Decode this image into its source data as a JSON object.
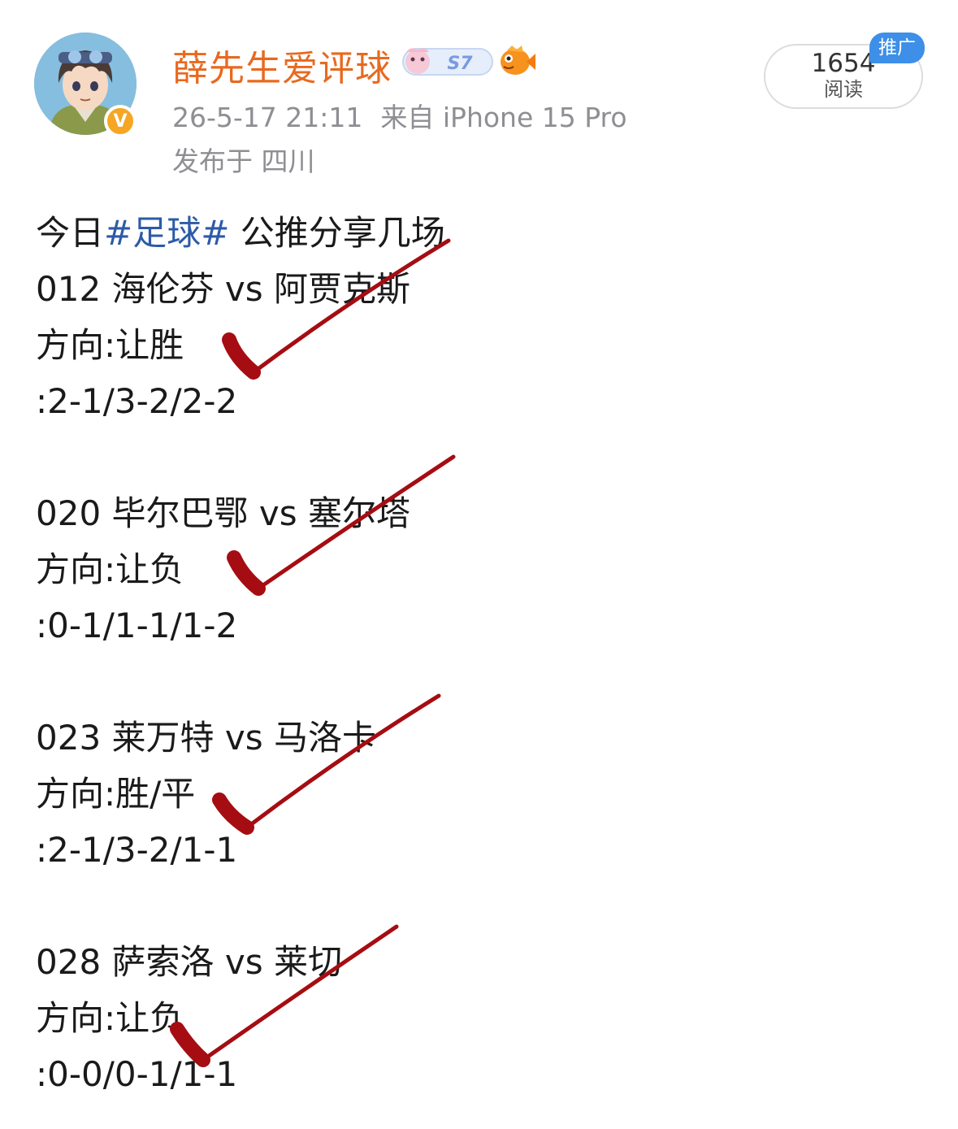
{
  "user": {
    "name": "薛先生爱评球",
    "badge_text": "S7",
    "verified_mark": "V",
    "avatar_icon": "anime-avatar-icon"
  },
  "meta": {
    "datetime": "26-5-17 21:11",
    "source": "来自 iPhone 15 Pro",
    "location": "发布于 四川"
  },
  "reads": {
    "count": "1654",
    "label": "阅读",
    "promo": "推广"
  },
  "post": {
    "intro_before": "今日",
    "hashtag": "#足球#",
    "intro_after": " 公推分享几场",
    "matches": [
      {
        "title": "012 海伦芬 vs 阿贾克斯",
        "direction": "方向:让胜",
        "scores": ":2-1/3-2/2-2"
      },
      {
        "title": "020 毕尔巴鄂 vs 塞尔塔",
        "direction": "方向:让负",
        "scores": ":0-1/1-1/1-2"
      },
      {
        "title": "023 莱万特 vs 马洛卡",
        "direction": "方向:胜/平",
        "scores": ":2-1/3-2/1-1"
      },
      {
        "title": "028 萨索洛 vs 莱切",
        "direction": "方向:让负",
        "scores": ":0-0/0-1/1-1"
      }
    ]
  },
  "colors": {
    "username": "#e8691f",
    "hashtag": "#2c5ba8",
    "check": "#a50d12",
    "meta": "#8e8e93",
    "promo": "#3d8fe8"
  }
}
